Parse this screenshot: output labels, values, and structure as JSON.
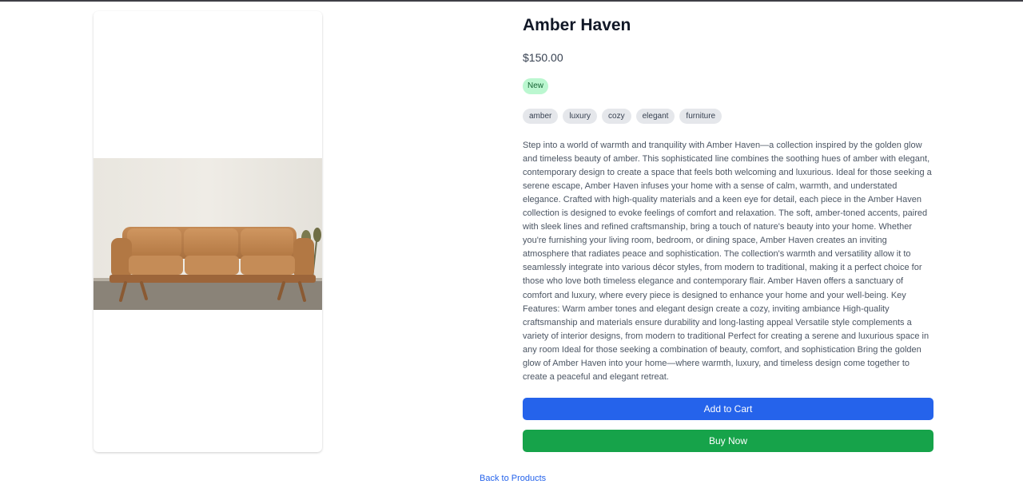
{
  "product": {
    "title": "Amber Haven",
    "price": "$150.00",
    "badge": "New",
    "tags": [
      "amber",
      "luxury",
      "cozy",
      "elegant",
      "furniture"
    ],
    "description": "Step into a world of warmth and tranquility with Amber Haven—a collection inspired by the golden glow and timeless beauty of amber. This sophisticated line combines the soothing hues of amber with elegant, contemporary design to create a space that feels both welcoming and luxurious. Ideal for those seeking a serene escape, Amber Haven infuses your home with a sense of calm, warmth, and understated elegance. Crafted with high-quality materials and a keen eye for detail, each piece in the Amber Haven collection is designed to evoke feelings of comfort and relaxation. The soft, amber-toned accents, paired with sleek lines and refined craftsmanship, bring a touch of nature's beauty into your home. Whether you're furnishing your living room, bedroom, or dining space, Amber Haven creates an inviting atmosphere that radiates peace and sophistication. The collection's warmth and versatility allow it to seamlessly integrate into various décor styles, from modern to traditional, making it a perfect choice for those who love both timeless elegance and contemporary flair. Amber Haven offers a sanctuary of comfort and luxury, where every piece is designed to enhance your home and your well-being. Key Features: Warm amber tones and elegant design create a cozy, inviting ambiance High-quality craftsmanship and materials ensure durability and long-lasting appeal Versatile style complements a variety of interior designs, from modern to traditional Perfect for creating a serene and luxurious space in any room Ideal for those seeking a combination of beauty, comfort, and sophistication Bring the golden glow of Amber Haven into your home—where warmth, luxury, and timeless design come together to create a peaceful and elegant retreat."
  },
  "actions": {
    "add_to_cart": "Add to Cart",
    "buy_now": "Buy Now",
    "back": "Back to Products"
  },
  "colors": {
    "primary": "#2563eb",
    "success": "#16a34a",
    "badge_bg": "#bbf7d0",
    "tag_bg": "#e5e7eb"
  }
}
